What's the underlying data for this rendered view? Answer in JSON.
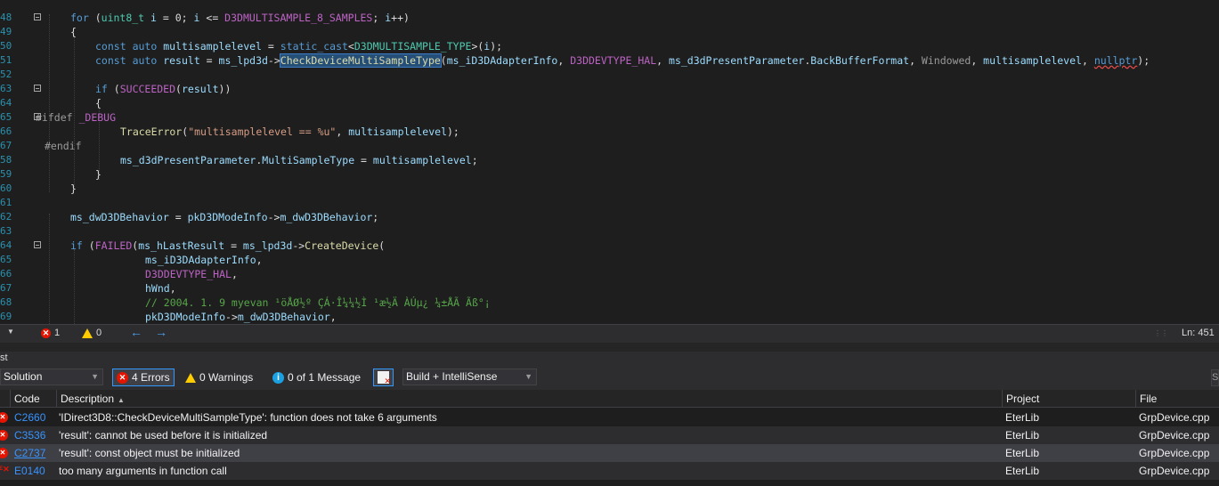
{
  "editor": {
    "lines": [
      {
        "num": "48",
        "html": "<span class='kw'>for</span> (<span class='ty'>uint8_t</span> <span class='var'>i</span> = 0; <span class='var'>i</span> &lt;= <span class='mac'>D3DMULTISAMPLE_8_SAMPLES</span>; <span class='var'>i</span>++)"
      },
      {
        "num": "49",
        "html": "{"
      },
      {
        "num": "50",
        "html": "<span class='kw'>const</span> <span class='kw'>auto</span> <span class='var'>multisamplelevel</span> = <span class='kw'>static_cast</span>&lt;<span class='ty'>D3DMULTISAMPLE_TYPE</span>&gt;(<span class='var'>i</span>);"
      },
      {
        "num": "51",
        "html": "<span class='kw'>const</span> <span class='kw'>auto</span> <span class='var'>result</span> = <span class='var'>ms_lpd3d</span>-&gt;<span class='fn sel'>CheckDeviceMultiSampleType</span>(<span class='var'>ms_iD3DAdapterInfo</span>, <span class='mac'>D3DDEVTYPE_HAL</span>, <span class='var'>ms_d3dPresentParameter</span>.<span class='var'>BackBufferFormat</span>, <span class='pre'>Windowed</span>, <span class='var'>multisamplelevel</span>, <span class='kw squig'>nullptr</span>);"
      },
      {
        "num": "52",
        "html": ""
      },
      {
        "num": "63",
        "html": "<span class='kw'>if</span> (<span class='mac'>SUCCEEDED</span>(<span class='var'>result</span>))"
      },
      {
        "num": "64",
        "html": "{"
      },
      {
        "num": "65",
        "html": "<span class='pre'>#ifdef</span> <span class='mac'>_DEBUG</span>"
      },
      {
        "num": "66",
        "html": "<span class='fn'>TraceError</span>(<span class='str'>\"multisamplelevel == %u\"</span>, <span class='var'>multisamplelevel</span>);"
      },
      {
        "num": "67",
        "html": "<span class='pre'>#endif</span>"
      },
      {
        "num": "58",
        "html": "<span class='var'>ms_d3dPresentParameter</span>.<span class='var'>MultiSampleType</span> = <span class='var'>multisamplelevel</span>;"
      },
      {
        "num": "59",
        "html": "}"
      },
      {
        "num": "60",
        "html": "}"
      },
      {
        "num": "61",
        "html": ""
      },
      {
        "num": "62",
        "html": "<span class='var'>ms_dwD3DBehavior</span> = <span class='var'>pkD3DModeInfo</span>-&gt;<span class='var'>m_dwD3DBehavior</span>;"
      },
      {
        "num": "63",
        "html": ""
      },
      {
        "num": "64",
        "html": "<span class='kw'>if</span> (<span class='mac'>FAILED</span>(<span class='var'>ms_hLastResult</span> = <span class='var'>ms_lpd3d</span>-&gt;<span class='fn'>CreateDevice</span>("
      },
      {
        "num": "65",
        "html": "<span class='var'>ms_iD3DAdapterInfo</span>,"
      },
      {
        "num": "66",
        "html": "<span class='mac'>D3DDEVTYPE_HAL</span>,"
      },
      {
        "num": "67",
        "html": "<span class='var'>hWnd</span>,"
      },
      {
        "num": "68",
        "html": "<span class='cmt'>// 2004. 1. 9 myevan ¹öÅØ½º ÇÁ·Î¼¼½Ì ¹æ½Ä ÀÚµ¿ ¼±ÅÃ Ãß°¡</span>"
      },
      {
        "num": "69",
        "html": "<span class='var'>pkD3DModeInfo</span>-&gt;<span class='var'>m_dwD3DBehavior</span>,"
      }
    ],
    "status": {
      "errors": "1",
      "warnings": "0",
      "line_indicator": "Ln: 451"
    }
  },
  "error_list": {
    "title": "st",
    "scope": "Solution",
    "errors_btn": "4 Errors",
    "warnings_btn": "0 Warnings",
    "messages_btn": "0 of 1 Message",
    "source": "Build + IntelliSense",
    "search_stub": "S",
    "columns": {
      "code": "Code",
      "description": "Description",
      "project": "Project",
      "file": "File"
    },
    "rows": [
      {
        "code": "C2660",
        "description": "'IDirect3D8::CheckDeviceMultiSampleType': function does not take 6 arguments",
        "project": "EterLib",
        "file": "GrpDevice.cpp"
      },
      {
        "code": "C3536",
        "description": "'result': cannot be used before it is initialized",
        "project": "EterLib",
        "file": "GrpDevice.cpp"
      },
      {
        "code": "C2737",
        "description": "'result': const object must be initialized",
        "project": "EterLib",
        "file": "GrpDevice.cpp"
      },
      {
        "code": "E0140",
        "description": "too many arguments in function call",
        "project": "EterLib",
        "file": "GrpDevice.cpp"
      }
    ]
  }
}
